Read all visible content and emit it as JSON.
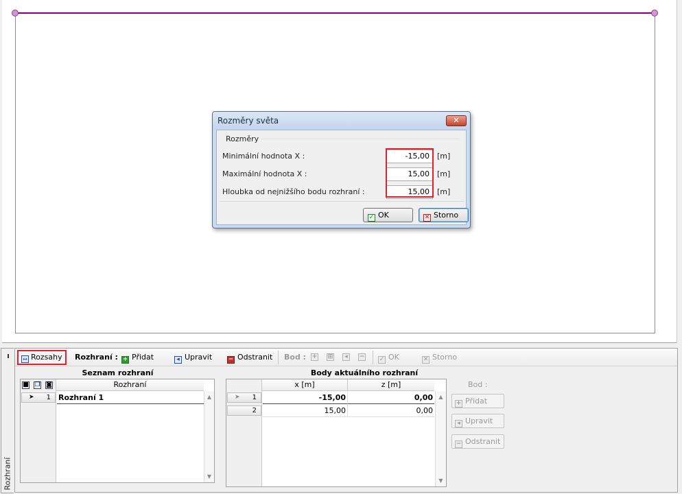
{
  "dialog": {
    "title": "Rozměry světa",
    "close_glyph": "✕",
    "group_label": "Rozměry",
    "fields": [
      {
        "label": "Minimální hodnota X :",
        "value": "-15,00",
        "unit": "[m]"
      },
      {
        "label": "Maximální hodnota X :",
        "value": "15,00",
        "unit": "[m]"
      },
      {
        "label": "Hloubka od nejnižšího bodu rozhraní :",
        "value": "15,00",
        "unit": "[m]"
      }
    ],
    "ok_label": "OK",
    "cancel_label": "Storno"
  },
  "side_tab": {
    "label": "Rozhraní"
  },
  "toolbar": {
    "rozsahy_label": "Rozsahy",
    "rozhrani_label": "Rozhraní :",
    "add_label": "Přidat",
    "edit_label": "Upravit",
    "remove_label": "Odstranit",
    "bod_label": "Bod :",
    "ok_label": "OK",
    "cancel_label": "Storno"
  },
  "interfaces": {
    "title": "Seznam rozhraní",
    "column_header": "Rozhraní",
    "rows": [
      {
        "index": "1",
        "name": "Rozhraní 1"
      }
    ]
  },
  "points": {
    "title": "Body aktuálního rozhraní",
    "columns": [
      "x [m]",
      "z [m]"
    ],
    "rows": [
      {
        "index": "1",
        "x": "-15,00",
        "z": "0,00"
      },
      {
        "index": "2",
        "x": "15,00",
        "z": "0,00"
      }
    ],
    "side_label": "Bod :",
    "add_label": "Přidat",
    "edit_label": "Upravit",
    "remove_label": "Odstranit"
  },
  "colors": {
    "interface_line": "#800080",
    "highlight": "#e0202a"
  },
  "icons": [
    "resize-arrows-icon",
    "add-plus-icon",
    "edit-arrow-icon",
    "remove-minus-icon",
    "check-icon",
    "cancel-x-icon"
  ]
}
